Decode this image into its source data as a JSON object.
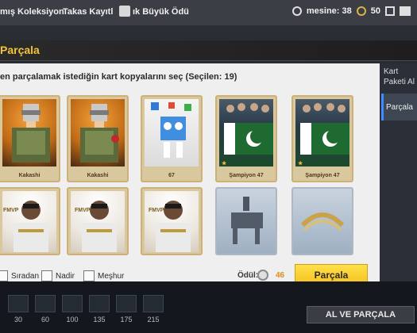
{
  "top_bar": {
    "tab_collections": "mış Koleksiyon",
    "tab_trade": "Takas Kayıtl",
    "tab_grand_prize": "ık Büyük Ödü",
    "season_label": "mesine: 38",
    "coin_count": "50"
  },
  "title": "Parçala",
  "dialog": {
    "instruction": "en parçalamak istediğin kart kopyalarını seç (Seçilen: 19)",
    "cards_row1": [
      {
        "label": "Kakashi",
        "art": "orange"
      },
      {
        "label": "Kakashi",
        "art": "orange"
      },
      {
        "label": "67",
        "art": "white"
      },
      {
        "label": "Şampiyon 47",
        "art": "team"
      },
      {
        "label": "Şampiyon 47",
        "art": "team"
      }
    ],
    "cards_row2": [
      {
        "label": "FMVP"
      },
      {
        "label": "FMVP"
      },
      {
        "label": "FMVP"
      },
      {
        "label": ""
      },
      {
        "label": ""
      }
    ],
    "filter_common": "Sıradan",
    "filter_rare": "Nadir",
    "filter_famous": "Meşhur",
    "reward_label": "Ödül:",
    "reward_value": "46",
    "parcala_button": "Parçala"
  },
  "right_panel": {
    "title": "Kart Paketi Al",
    "tab_active": "Parçala"
  },
  "bottom_strip": {
    "tiers": [
      "30",
      "60",
      "100",
      "135",
      "175",
      "215"
    ],
    "collect_button": "AL VE PARÇALA"
  },
  "colors": {
    "accent_yellow": "#f5c01c",
    "title_gold": "#f3c338",
    "reward_orange": "#e08a1a",
    "panel_blue": "#3c8dff"
  }
}
